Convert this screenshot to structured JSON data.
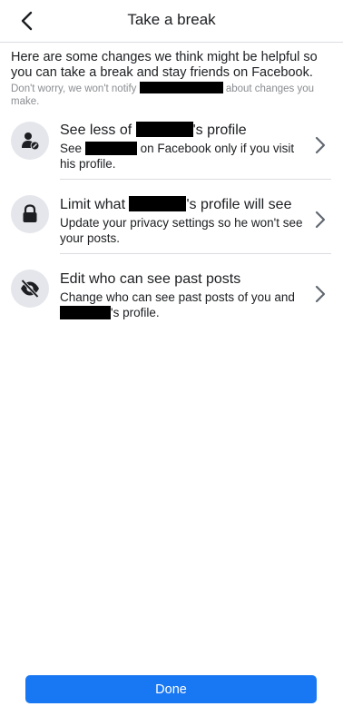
{
  "header": {
    "title": "Take a break"
  },
  "intro": {
    "text": "Here are some changes we think might be helpful so you can take a break and stay friends on Facebook.",
    "note_before": "Don't worry, we won't notify",
    "note_after": "about changes you make."
  },
  "options": [
    {
      "icon": "person-minus-icon",
      "title_before": "See less of",
      "title_after": "'s profile",
      "sub_before": "See",
      "sub_after": "on Facebook only if you visit his profile."
    },
    {
      "icon": "lock-icon",
      "title_before": "Limit what",
      "title_after": "'s profile will see",
      "sub": "Update your privacy settings so he won't see your posts."
    },
    {
      "icon": "eye-slash-icon",
      "title": "Edit who can see past posts",
      "sub_before": "Change who can see past posts of you and",
      "sub_after": "'s profile."
    }
  ],
  "footer": {
    "done_label": "Done"
  },
  "colors": {
    "accent": "#1877f2",
    "icon_bg": "#e4e6eb",
    "muted_text": "#8a8d91"
  }
}
